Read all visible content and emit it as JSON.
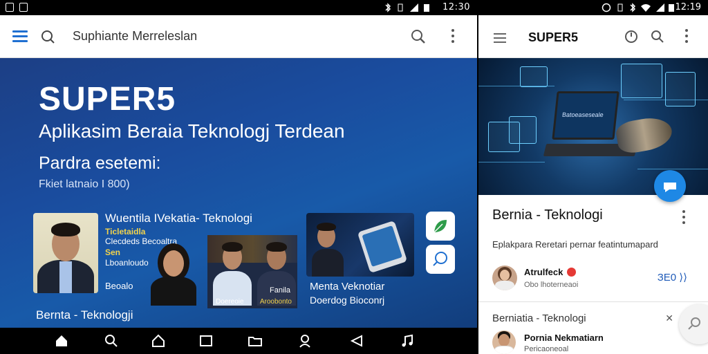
{
  "left": {
    "status": {
      "time": "12:30"
    },
    "appbar": {
      "title": "Suphiante Merreleslan"
    },
    "hero": {
      "brand": "SUPER5",
      "tagline": "Aplikasim Beraia Teknologj Terdean",
      "subtitle": "Pardra esetemi:",
      "small": "Fkiet latnaio I 800)"
    },
    "news": {
      "title": "Wuentila IVekatia- Teknologi",
      "meta1": "Ticletaidla",
      "meta2": "Clecdeds Becoaltra",
      "meta3": "Sen",
      "meta4": "Lboanloudo",
      "meta5": "Beoalo"
    },
    "card_c": {
      "label_left": "Doereoie",
      "label_right": "Aroobonto",
      "label_top": "Fanila"
    },
    "card_d": {
      "title": "Menta Veknotiar",
      "subtitle": "Doerdog Bioconrj"
    },
    "bottom_caption": "Bernta - Teknologji"
  },
  "right": {
    "status": {
      "time": "12:19"
    },
    "appbar": {
      "title": "SUPER5"
    },
    "feature": {
      "screen_text": "Batoeaseseale"
    },
    "card": {
      "title": "Bernia - Teknologi",
      "description": "Eplakpara    Reretari pernar featintumapard",
      "author_name": "Atrulfeck",
      "author_role": "Obo lhoterneaoi",
      "action": "ЗЕ0 ⟩⟩"
    },
    "list": {
      "title": "Berniatia - Teknologi",
      "close": "✕",
      "item_name": "Pornia Nekmatiarn",
      "item_sub": "Pericaoneoal"
    }
  }
}
